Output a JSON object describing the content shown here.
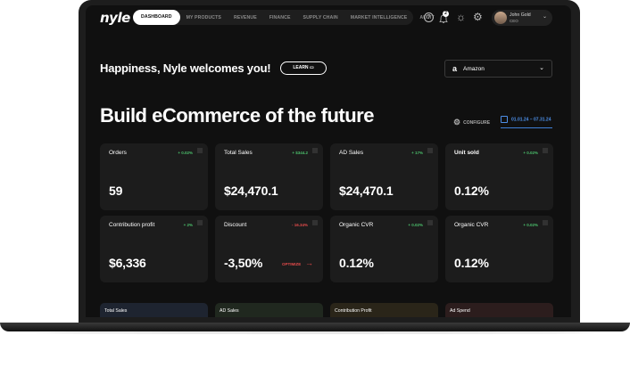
{
  "nav": {
    "logo": "nyle",
    "tabs": [
      "DASHBOARD",
      "MY PRODUCTS",
      "REVENUE",
      "FINANCE",
      "SUPPLY CHAIN",
      "MARKET INTELLIGENCE",
      "AUDIT"
    ],
    "active_tab": "DASHBOARD",
    "help_icon": "?",
    "notification_count": "2",
    "icons": [
      "help-icon",
      "bell-icon",
      "sun-icon",
      "gear-icon"
    ],
    "user": {
      "name": "John Gold",
      "role": "CEO"
    }
  },
  "welcome": {
    "text": "Happiness, Nyle welcomes you!",
    "learn_label": "LEARN"
  },
  "store_select": {
    "logo": "a",
    "value": "Amazon"
  },
  "headline": "Build eCommerce of the future",
  "configure_label": "CONFIGURE",
  "date_range": "01.01.24 – 07.31.24",
  "metrics": [
    {
      "title": "Orders",
      "delta": "+ 0.02%",
      "value": "59"
    },
    {
      "title": "Total Sales",
      "delta": "+ $344.2",
      "value": "$24,470.1"
    },
    {
      "title": "AD Sales",
      "delta": "+ 17%",
      "value": "$24,470.1"
    },
    {
      "title": "Unit sold",
      "delta": "+ 0.02%",
      "value": "0.12%"
    },
    {
      "title": "Contribution profit",
      "delta": "+ 2%",
      "value": "$6,336"
    },
    {
      "title": "Discount",
      "delta": "- 16.34%",
      "value": "-3,50%",
      "action": "OPTIMIZE"
    },
    {
      "title": "Organic CVR",
      "delta": "+ 0.02%",
      "value": "0.12%"
    },
    {
      "title": "Organic CVR",
      "delta": "+ 0.02%",
      "value": "0.12%"
    }
  ],
  "bottom_cards": [
    "Total Sales",
    "AD Sales",
    "Contribution Profit",
    "Ad Spend"
  ],
  "colors": {
    "accent_blue": "#4d8fe8",
    "positive": "#4bbf6b",
    "negative": "#e04a4a",
    "card": "#1c1c1c",
    "background": "#101010"
  }
}
